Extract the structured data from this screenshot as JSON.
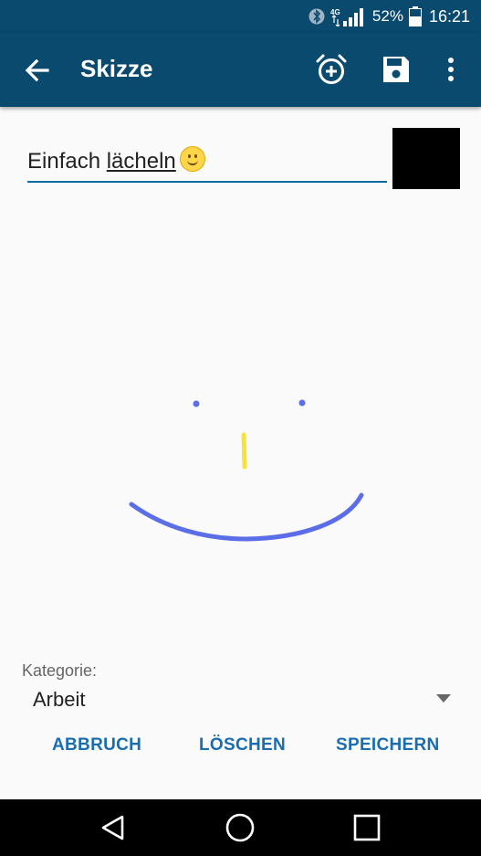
{
  "status": {
    "network": "4G",
    "battery": "52%",
    "time": "16:21"
  },
  "appbar": {
    "title": "Skizze",
    "icons": [
      "back-arrow-icon",
      "alarm-add-icon",
      "save-icon",
      "more-vert-icon"
    ]
  },
  "note": {
    "title_plain": "Einfach ",
    "title_underlined": "lächeln",
    "emoji": "slightly-smiling-face",
    "color": "#000000"
  },
  "sketch": {
    "stroke_colors": [
      "#5b6ee8",
      "#f7e23a"
    ]
  },
  "category": {
    "label": "Kategorie:",
    "value": "Arbeit"
  },
  "actions": {
    "cancel": "ABBRUCH",
    "delete": "LÖSCHEN",
    "save": "SPEICHERN"
  },
  "colors": {
    "primary": "#0a4a6e",
    "accent": "#1a6db0"
  }
}
